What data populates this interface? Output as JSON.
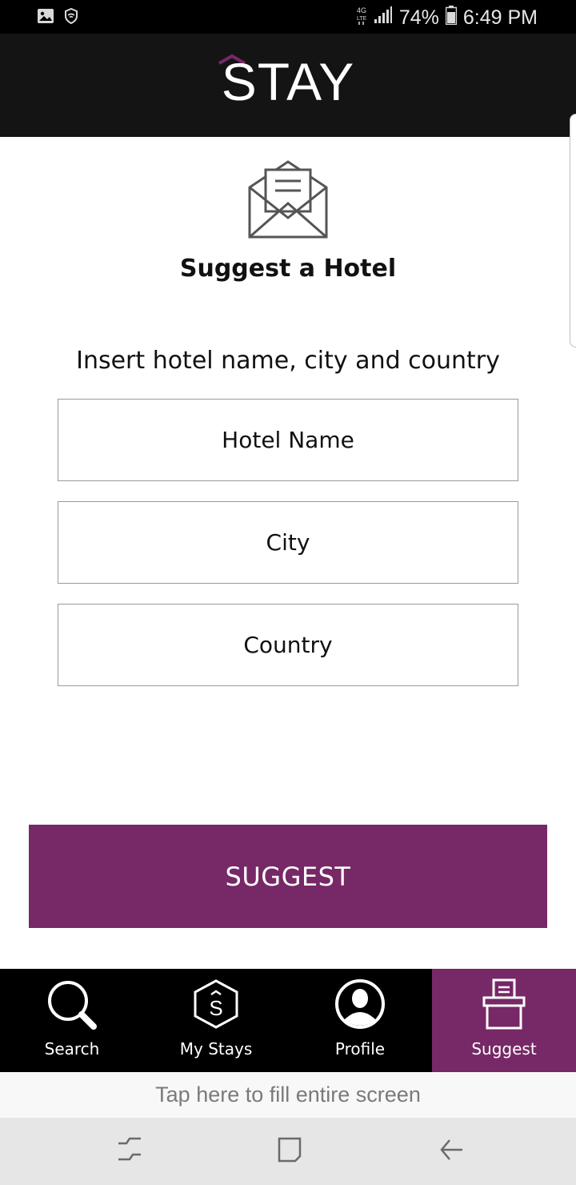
{
  "status_bar": {
    "battery": "74%",
    "time": "6:49 PM",
    "network": "4G LTE",
    "icons": [
      "image-icon",
      "vpn-shield-icon",
      "signal-icon",
      "battery-icon"
    ]
  },
  "header": {
    "logo_text": "STAY"
  },
  "main": {
    "title": "Suggest a Hotel",
    "instruction": "Insert hotel name, city and country",
    "fields": {
      "hotel_name_placeholder": "Hotel Name",
      "city_placeholder": "City",
      "country_placeholder": "Country"
    },
    "submit_label": "SUGGEST"
  },
  "bottom_nav": {
    "items": [
      {
        "label": "Search",
        "icon": "search-icon"
      },
      {
        "label": "My Stays",
        "icon": "my-stays-icon"
      },
      {
        "label": "Profile",
        "icon": "profile-icon"
      },
      {
        "label": "Suggest",
        "icon": "suggest-box-icon"
      }
    ],
    "active": "Suggest"
  },
  "fill_screen_prompt": "Tap here to fill entire screen",
  "colors": {
    "accent": "#772866",
    "header_bg": "#141414",
    "nav_bg": "#000000"
  }
}
